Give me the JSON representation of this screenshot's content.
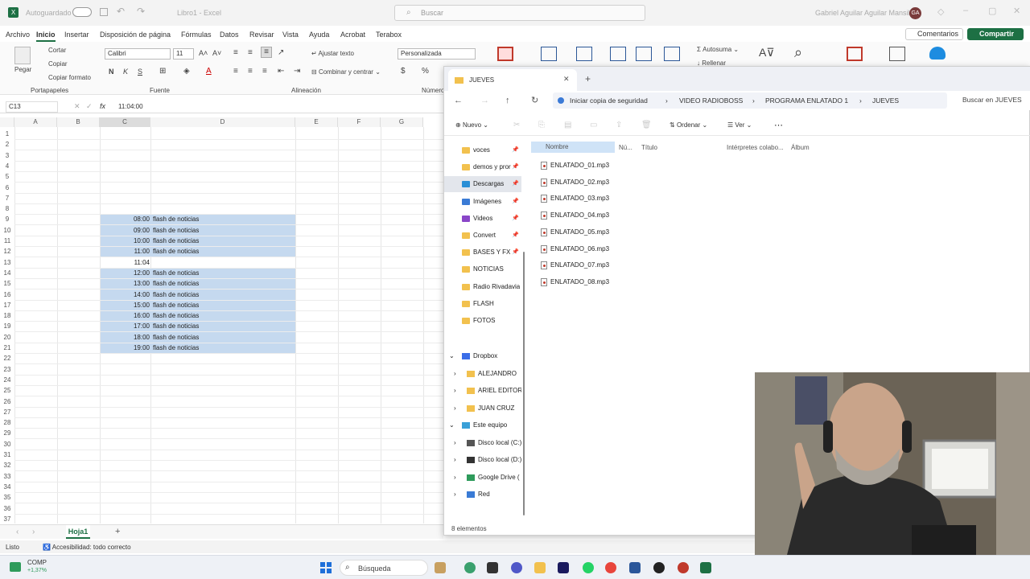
{
  "excel": {
    "autosave": "Autoguardado",
    "doc_title": "Libro1 - Excel",
    "search_placeholder": "Buscar",
    "user": "Gabriel Aguilar Aguilar Mansilla",
    "avatar": "GA",
    "tabs": [
      "Archivo",
      "Inicio",
      "Insertar",
      "Disposición de página",
      "Fórmulas",
      "Datos",
      "Revisar",
      "Vista",
      "Ayuda",
      "Acrobat",
      "Terabox"
    ],
    "comments_btn": "Comentarios",
    "share_btn": "Compartir",
    "ribbon": {
      "paste": "Pegar",
      "cut": "Cortar",
      "copy": "Copiar",
      "format_painter": "Copiar formato",
      "clipboard_group": "Portapapeles",
      "font_name": "Calibri",
      "font_size": "11",
      "font_group": "Fuente",
      "wrap_text": "Ajustar texto",
      "merge_center": "Combinar y centrar",
      "alignment_group": "Alineación",
      "number_format": "Personalizada",
      "number_group": "Número",
      "autosum": "Autosuma",
      "fill": "Rellenar"
    },
    "name_box": "C13",
    "formula_value": "11:04:00",
    "columns": [
      "A",
      "B",
      "C",
      "D",
      "E",
      "F",
      "G"
    ],
    "rows": [
      {
        "n": "1",
        "t": "",
        "v": ""
      },
      {
        "n": "2",
        "t": "",
        "v": ""
      },
      {
        "n": "3",
        "t": "",
        "v": ""
      },
      {
        "n": "4",
        "t": "",
        "v": ""
      },
      {
        "n": "5",
        "t": "",
        "v": ""
      },
      {
        "n": "6",
        "t": "",
        "v": ""
      },
      {
        "n": "7",
        "t": "",
        "v": ""
      },
      {
        "n": "8",
        "t": "",
        "v": ""
      },
      {
        "n": "9",
        "t": "08:00",
        "v": "flash de noticias"
      },
      {
        "n": "10",
        "t": "09:00",
        "v": "flash de noticias"
      },
      {
        "n": "11",
        "t": "10:00",
        "v": "flash de noticias"
      },
      {
        "n": "12",
        "t": "11:00",
        "v": "flash de noticias"
      },
      {
        "n": "13",
        "t": "11:04",
        "v": ""
      },
      {
        "n": "14",
        "t": "12:00",
        "v": "flash de noticias"
      },
      {
        "n": "15",
        "t": "13:00",
        "v": "flash de noticias"
      },
      {
        "n": "16",
        "t": "14:00",
        "v": "flash de noticias"
      },
      {
        "n": "17",
        "t": "15:00",
        "v": "flash de noticias"
      },
      {
        "n": "18",
        "t": "16:00",
        "v": "flash de noticias"
      },
      {
        "n": "19",
        "t": "17:00",
        "v": "flash de noticias"
      },
      {
        "n": "20",
        "t": "18:00",
        "v": "flash de noticias"
      },
      {
        "n": "21",
        "t": "19:00",
        "v": "flash de noticias"
      },
      {
        "n": "22",
        "t": "",
        "v": ""
      },
      {
        "n": "23",
        "t": "",
        "v": ""
      },
      {
        "n": "24",
        "t": "",
        "v": ""
      },
      {
        "n": "25",
        "t": "",
        "v": ""
      },
      {
        "n": "26",
        "t": "",
        "v": ""
      },
      {
        "n": "27",
        "t": "",
        "v": ""
      },
      {
        "n": "28",
        "t": "",
        "v": ""
      },
      {
        "n": "29",
        "t": "",
        "v": ""
      },
      {
        "n": "30",
        "t": "",
        "v": ""
      },
      {
        "n": "31",
        "t": "",
        "v": ""
      },
      {
        "n": "32",
        "t": "",
        "v": ""
      },
      {
        "n": "33",
        "t": "",
        "v": ""
      },
      {
        "n": "34",
        "t": "",
        "v": ""
      },
      {
        "n": "35",
        "t": "",
        "v": ""
      },
      {
        "n": "36",
        "t": "",
        "v": ""
      },
      {
        "n": "37",
        "t": "",
        "v": ""
      }
    ],
    "sheet_tab": "Hoja1",
    "status_ready": "Listo",
    "accessibility": "Accesibilidad: todo correcto"
  },
  "explorer": {
    "tab_title": "JUEVES",
    "backup": "Iniciar copia de seguridad",
    "breadcrumb": [
      "VIDEO RADIOBOSS",
      "PROGRAMA ENLATADO 1",
      "JUEVES"
    ],
    "search_placeholder": "Buscar en JUEVES",
    "new_btn": "Nuevo",
    "sort_btn": "Ordenar",
    "view_btn": "Ver",
    "nav": [
      "voces",
      "demos y pror",
      "Descargas",
      "Imágenes",
      "Videos",
      "Convert",
      "BASES Y FX",
      "NOTICIAS",
      "Radio Rivadavia",
      "FLASH",
      "FOTOS"
    ],
    "dropbox": "Dropbox",
    "dropbox_items": [
      "ALEJANDRO",
      "ARIEL EDITOR",
      "JUAN CRUZ"
    ],
    "this_pc": "Este equipo",
    "pc_items": [
      "Disco local (C:)",
      "Disco local (D:)",
      "Google Drive (",
      "Red"
    ],
    "columns": [
      "Nombre",
      "Nú...",
      "Título",
      "Intérpretes colabo...",
      "Álbum"
    ],
    "files": [
      "ENLATADO_01.mp3",
      "ENLATADO_02.mp3",
      "ENLATADO_03.mp3",
      "ENLATADO_04.mp3",
      "ENLATADO_05.mp3",
      "ENLATADO_06.mp3",
      "ENLATADO_07.mp3",
      "ENLATADO_08.mp3"
    ],
    "status": "8 elementos"
  },
  "taskbar": {
    "weather": "COMP",
    "weather_sub": "+1,37%",
    "search": "Búsqueda"
  }
}
